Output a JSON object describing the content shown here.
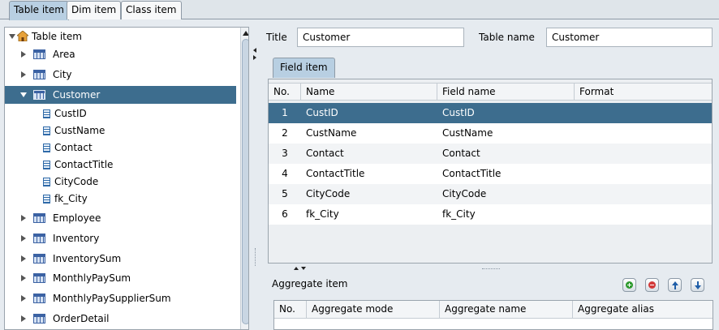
{
  "tabs": {
    "items": [
      {
        "label": "Table item",
        "active": true
      },
      {
        "label": "Dim item",
        "active": false
      },
      {
        "label": "Class item",
        "active": false
      }
    ]
  },
  "tree": {
    "root": "Table item",
    "rows": [
      {
        "label": "Area",
        "kind": "table",
        "expanded": false
      },
      {
        "label": "City",
        "kind": "table",
        "expanded": false
      },
      {
        "label": "Customer",
        "kind": "table",
        "expanded": true,
        "selected": true
      },
      {
        "label": "CustID",
        "kind": "field"
      },
      {
        "label": "CustName",
        "kind": "field"
      },
      {
        "label": "Contact",
        "kind": "field"
      },
      {
        "label": "ContactTitle",
        "kind": "field"
      },
      {
        "label": "CityCode",
        "kind": "field"
      },
      {
        "label": "fk_City",
        "kind": "field"
      },
      {
        "label": "Employee",
        "kind": "table",
        "expanded": false
      },
      {
        "label": "Inventory",
        "kind": "table",
        "expanded": false
      },
      {
        "label": "InventorySum",
        "kind": "table",
        "expanded": false
      },
      {
        "label": "MonthlyPaySum",
        "kind": "table",
        "expanded": false
      },
      {
        "label": "MonthlyPaySupplierSum",
        "kind": "table",
        "expanded": false
      },
      {
        "label": "OrderDetail",
        "kind": "table",
        "expanded": false
      }
    ]
  },
  "form": {
    "title_label": "Title",
    "title_value": "Customer",
    "table_name_label": "Table name",
    "table_name_value": "Customer"
  },
  "field_tab": {
    "label": "Field item"
  },
  "field_table": {
    "columns": [
      "No.",
      "Name",
      "Field name",
      "Format"
    ],
    "rows": [
      {
        "no": "1",
        "name": "CustID",
        "field": "CustID",
        "format": ""
      },
      {
        "no": "2",
        "name": "CustName",
        "field": "CustName",
        "format": ""
      },
      {
        "no": "3",
        "name": "Contact",
        "field": "Contact",
        "format": ""
      },
      {
        "no": "4",
        "name": "ContactTitle",
        "field": "ContactTitle",
        "format": ""
      },
      {
        "no": "5",
        "name": "CityCode",
        "field": "CityCode",
        "format": ""
      },
      {
        "no": "6",
        "name": "fk_City",
        "field": "fk_City",
        "format": ""
      }
    ],
    "selected_row": 0
  },
  "aggregate": {
    "label": "Aggregate item",
    "columns": [
      "No.",
      "Aggregate mode",
      "Aggregate name",
      "Aggregate alias"
    ],
    "buttons": [
      {
        "name": "add-icon",
        "color": "#2e9a2e"
      },
      {
        "name": "remove-icon",
        "color": "#d23a3a"
      },
      {
        "name": "move-up-icon",
        "color": "#1f5ea8"
      },
      {
        "name": "move-down-icon",
        "color": "#1f5ea8"
      }
    ]
  },
  "colors": {
    "selection": "#3d6d8e",
    "active_tab": "#b8cfe2"
  }
}
